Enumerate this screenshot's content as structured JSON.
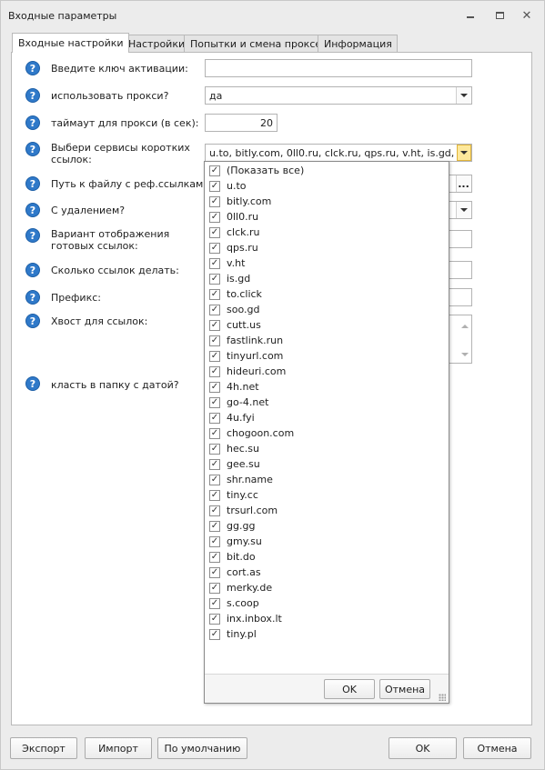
{
  "window": {
    "title": "Входные параметры",
    "min_icon": "minimize-icon",
    "max_icon": "maximize-icon",
    "close_icon": "close-icon"
  },
  "tabs": [
    {
      "label": "Входные настройки",
      "active": true
    },
    {
      "label": "Настройки",
      "active": false
    },
    {
      "label": "Попытки и смена проксей",
      "active": false
    },
    {
      "label": "Информация",
      "active": false
    }
  ],
  "form": {
    "help_glyph": "?",
    "activation_key": {
      "label": "Введите ключ активации:",
      "value": ""
    },
    "use_proxy": {
      "label": "использовать прокси?",
      "value": "да"
    },
    "proxy_timeout": {
      "label": "таймаут для прокси (в сек):",
      "value": "20"
    },
    "short_services": {
      "label": "Выбери сервисы коротких ссылок:",
      "value": "u.to, bitly.com, 0ll0.ru, clck.ru, qps.ru, v.ht, is.gd, to..."
    },
    "ref_file_path": {
      "label": "Путь к файлу с реф.ссылками:",
      "browse": "..."
    },
    "with_delete": {
      "label": "С удалением?"
    },
    "display_variant": {
      "label": "Вариант отображения готовых ссылок:"
    },
    "link_count": {
      "label": "Сколько ссылок делать:"
    },
    "prefix": {
      "label": "Префикс:"
    },
    "tail": {
      "label": "Хвост для ссылок:"
    },
    "dated_folder": {
      "label": "класть в  папку с датой?"
    }
  },
  "dropdown": {
    "show_all": "(Показать все)",
    "check_glyph": "✓",
    "items": [
      "u.to",
      "bitly.com",
      "0ll0.ru",
      "clck.ru",
      "qps.ru",
      "v.ht",
      "is.gd",
      "to.click",
      "soo.gd",
      "cutt.us",
      "fastlink.run",
      "tinyurl.com",
      "hideuri.com",
      "4h.net",
      "go-4.net",
      "4u.fyi",
      "chogoon.com",
      "hec.su",
      "gee.su",
      "shr.name",
      "tiny.cc",
      "trsurl.com",
      "gg.gg",
      "gmy.su",
      "bit.do",
      "cort.as",
      "merky.de",
      "s.coop",
      "inx.inbox.lt",
      "tiny.pl"
    ],
    "ok": "OK",
    "cancel": "Отмена"
  },
  "footer": {
    "export": "Экспорт",
    "import": "Импорт",
    "defaults": "По умолчанию",
    "ok": "OK",
    "cancel": "Отмена"
  },
  "colors": {
    "help_icon": "#2f79c9",
    "hot_combo_button": "#fde89b"
  }
}
